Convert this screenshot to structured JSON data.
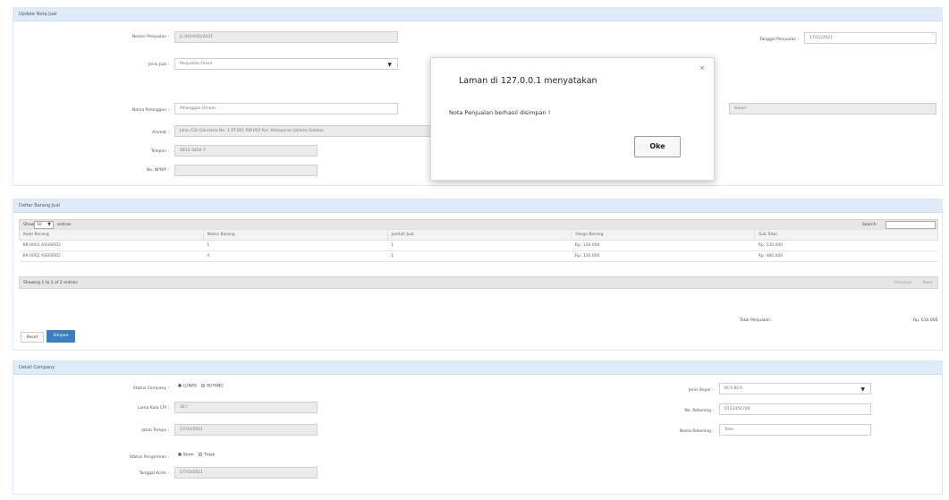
{
  "penjualan": {
    "title": "Update Nota Jual",
    "nomor_label": "Nomor Penjualan :",
    "nomor_value": "JL-0019/02/2021",
    "jenis_label": "Jenis Jual :",
    "jenis_value": "Penjualan Grosir",
    "pelanggan_label": "Nama Pelanggan :",
    "pelanggan_value": "Pelanggan Umum",
    "alamat_label": "Alamat :",
    "alamat_value": "Jalan Ciki Gandaria No. 1 RT.001 RW.002 Kel. Kebayoran Jakarta Selatan",
    "telepon_label": "Telepon :",
    "telepon_value": "0812-3456-7",
    "npwp_label": "No. NPWP :",
    "npwp_value": "",
    "tanggal_label": "Tanggal Penjualan :",
    "tanggal_value": "17/02/2021",
    "right_field_value": "Grosir"
  },
  "barang": {
    "title": "Daftar Barang Jual",
    "show_label": "Show",
    "show_value": "10",
    "entries_label": "entries",
    "search_label": "Search:",
    "columns": [
      "Kode Barang",
      "Nama Barang",
      "Jumlah Jual",
      "Harga Barang",
      "Sub Total"
    ],
    "rows": [
      [
        "BR-0001 ASUSRED",
        "1",
        "1",
        "Rp. 130.000",
        "Rp. 130.000"
      ],
      [
        "BR-0002 ASUSRED",
        "4",
        "1",
        "Rp. 130.000",
        "Rp. 480.000"
      ]
    ],
    "info": "Showing 1 to 2 of 2 entries",
    "prev_label": "Previous",
    "next_label": "Next",
    "total_label": "Total Penjualan :",
    "total_value": "Rp. 610.000",
    "reset_label": "Reset",
    "simpan_label": "Simpan"
  },
  "company": {
    "title": "Detail Company",
    "status_label": "Status Company :",
    "status_opt1": "LUNAS",
    "status_opt2": "KUTANG",
    "lama_label": "Lama Kala CPI :",
    "lama_value": "30 /",
    "jatuh_label": "Jatuh Tempo :",
    "jatuh_value": "17/03/2021",
    "metode_label": "Status Pengiriman :",
    "metode_opt1": "Kirim",
    "metode_opt2": "Tidak",
    "tgl_kirim_label": "Tanggal Kirim :",
    "tgl_kirim_value": "17/02/2021",
    "jenis_bayar_label": "Jenis Bayar :",
    "jenis_bayar_value": "BCA BCA",
    "no_rek_label": "No. Rekening :",
    "no_rek_value": "0123456789",
    "nama_rek_label": "Nama Rekening :",
    "nama_rek_value": "Toko"
  },
  "dialog": {
    "title": "Laman di 127.0.0.1 menyatakan",
    "message": "Nota Penjualan berhasil disimpan !",
    "ok_label": "Oke",
    "close_glyph": "×"
  },
  "colors": {
    "header_bg": "#ddecf8",
    "primary": "#3a7fc1"
  }
}
